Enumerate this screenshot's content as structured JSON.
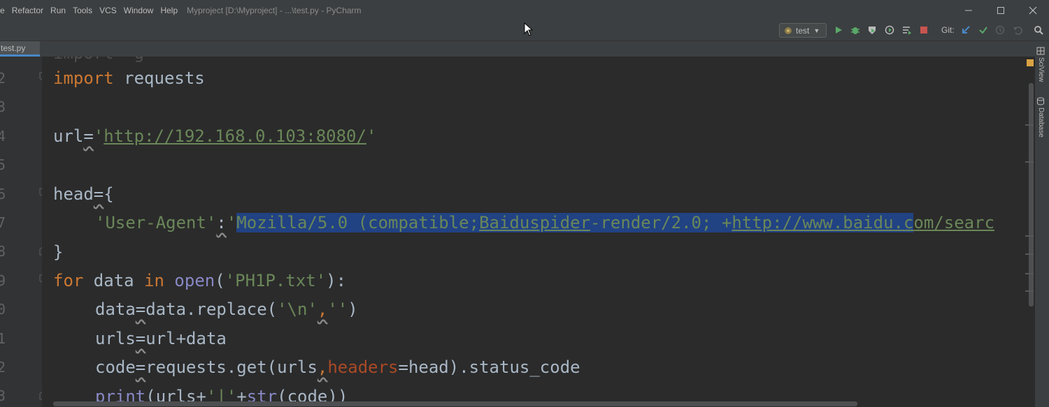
{
  "menu": {
    "items": [
      "e",
      "Refactor",
      "Run",
      "Tools",
      "VCS",
      "Window",
      "Help"
    ],
    "window_title": "Myproject [D:\\Myproject] - ...\\test.py - PyCharm"
  },
  "toolbar": {
    "run_config": "test",
    "git_label": "Git:",
    "icons": [
      "run-icon",
      "debug-icon",
      "coverage-icon",
      "profile-icon",
      "concurrency-icon",
      "stop-icon",
      "vcs-update-icon",
      "vcs-commit-icon",
      "history-icon",
      "revert-icon",
      "search-everywhere-icon"
    ]
  },
  "tabs": [
    {
      "label": "test.py",
      "active": true
    }
  ],
  "gutter": {
    "line_numbers": [
      "2",
      "3",
      "4",
      "5",
      "6",
      "7",
      "8",
      "9",
      "0",
      "1",
      "2",
      "3"
    ]
  },
  "code": {
    "line_ghost": "import  g",
    "line_import": {
      "kw": "import",
      "rest": " requests"
    },
    "line_url": {
      "name": "url",
      "op": "=",
      "q1": "'",
      "value": "http://192.168.0.103:8080/",
      "q2": "'"
    },
    "line_head": {
      "name": "head",
      "op": "=",
      "brace": "{"
    },
    "line_ua": {
      "key": "'User-Agent'",
      "colon": ":",
      "q": "'",
      "p1": "Mozilla/5.0 (compatible;",
      "p2": "Baiduspider",
      "p3": "-render/2.0; +",
      "p4": "http://www.baidu.c",
      "p5": "om/searc"
    },
    "line_close": "}",
    "line_for": {
      "kw1": "for",
      "v1": " data ",
      "kw2": "in",
      "sp": " ",
      "fn": "open",
      "o": "(",
      "s": "'PH1P.txt'",
      "c": "):"
    },
    "line_replace": {
      "name": "data",
      "op": "=",
      "rest": "data.replace(",
      "s1": "'\\n'",
      "comma": ",",
      "s2": "''",
      "close": ")"
    },
    "line_urls": {
      "name": "urls",
      "op": "=",
      "rest": "url+data"
    },
    "line_code": {
      "name": "code",
      "op": "=",
      "call": "requests.get(urls",
      "comma": ",",
      "param": "headers",
      "rest": "=head).status_code"
    },
    "line_print": {
      "fn": "print",
      "o": "(urls+",
      "s": "'|'",
      "plus": "+",
      "fn2": "str",
      "rest": "(code))"
    }
  },
  "right_tools": [
    "SciView",
    "Database"
  ],
  "colors": {
    "editor_bg": "#2b2b2b",
    "keyword": "#cc7832",
    "string": "#6a8759",
    "selection": "#214283",
    "builtin": "#8888c6",
    "param": "#aa4926"
  }
}
